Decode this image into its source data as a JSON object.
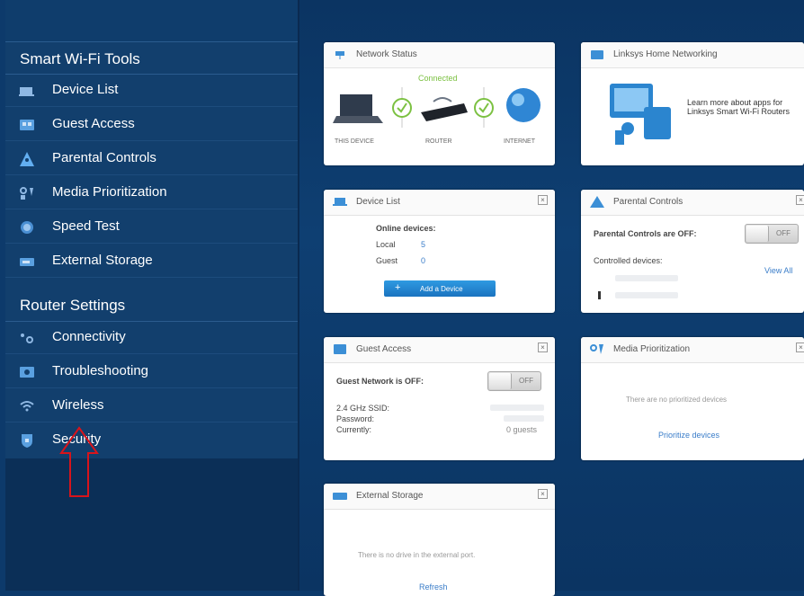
{
  "sidebar": {
    "smart_tools_header": "Smart Wi-Fi Tools",
    "smart_tools": [
      {
        "label": "Device List",
        "icon": "device-list-icon"
      },
      {
        "label": "Guest Access",
        "icon": "guest-access-icon"
      },
      {
        "label": "Parental Controls",
        "icon": "parental-controls-icon"
      },
      {
        "label": "Media Prioritization",
        "icon": "media-prioritization-icon"
      },
      {
        "label": "Speed Test",
        "icon": "speed-test-icon"
      },
      {
        "label": "External Storage",
        "icon": "external-storage-icon"
      }
    ],
    "router_settings_header": "Router Settings",
    "router_settings": [
      {
        "label": "Connectivity",
        "icon": "connectivity-icon"
      },
      {
        "label": "Troubleshooting",
        "icon": "troubleshooting-icon"
      },
      {
        "label": "Wireless",
        "icon": "wireless-icon"
      },
      {
        "label": "Security",
        "icon": "security-icon"
      }
    ]
  },
  "widgets": {
    "network_status": {
      "title": "Network Status",
      "status": "Connected",
      "labels": [
        "THIS DEVICE",
        "ROUTER",
        "INTERNET"
      ]
    },
    "home_networking": {
      "title": "Linksys Home Networking",
      "promo": "Learn more about apps for Linksys Smart Wi-Fi Routers"
    },
    "device_list": {
      "title": "Device List",
      "online_label": "Online devices:",
      "local_label": "Local",
      "local_count": "5",
      "guest_label": "Guest",
      "guest_count": "0",
      "add_button": "Add a Device"
    },
    "parental_controls": {
      "title": "Parental Controls",
      "status_label": "Parental Controls are OFF:",
      "toggle": "OFF",
      "controlled_label": "Controlled devices:",
      "view_all": "View All"
    },
    "guest_access": {
      "title": "Guest Access",
      "status_label": "Guest Network is OFF:",
      "toggle": "OFF",
      "ssid_label": "2.4 GHz SSID:",
      "password_label": "Password:",
      "currently_label": "Currently:",
      "guests": "0 guests"
    },
    "media_prioritization": {
      "title": "Media Prioritization",
      "empty_text": "There are no prioritized devices",
      "link": "Prioritize devices"
    },
    "external_storage": {
      "title": "External Storage",
      "empty_text": "There is no drive in the external port.",
      "link": "Refresh"
    }
  },
  "colors": {
    "sidebar_bg": "#123f6d",
    "main_bg": "#0e3f72",
    "connected_green": "#7cc142",
    "link_blue": "#3a7dc9",
    "arrow_red": "#d8141b"
  }
}
